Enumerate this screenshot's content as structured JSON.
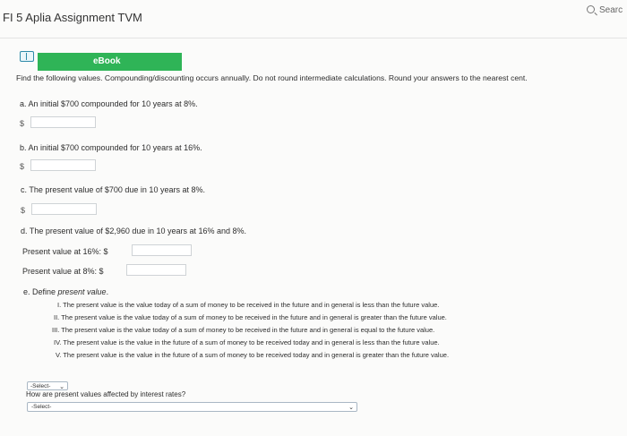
{
  "header": {
    "title": "FI 5 Aplia Assignment TVM",
    "search_label": "Searc"
  },
  "ebook": {
    "label": "eBook"
  },
  "instructions": "Find the following values. Compounding/discounting occurs annually. Do not round intermediate calculations. Round your answers to the nearest cent.",
  "q_a": {
    "text": "a. An initial $700 compounded for 10 years at 8%.",
    "currency": "$",
    "value": ""
  },
  "q_b": {
    "text": "b. An initial $700 compounded for 10 years at 16%.",
    "currency": "$",
    "value": ""
  },
  "q_c": {
    "text": "c. The present value of $700 due in 10 years at 8%.",
    "currency": "$",
    "value": ""
  },
  "q_d": {
    "text": "d. The present value of $2,960 due in 10 years at 16% and 8%.",
    "pv16_label": "Present value at 16%: $",
    "pv8_label": "Present value at 8%: $",
    "pv16_value": "",
    "pv8_value": ""
  },
  "q_e": {
    "prefix": "e. Define ",
    "term": "present value",
    "suffix": ".",
    "options": [
      "I. The present value is the value today of a sum of money to be received in the future and in general is less than the future value.",
      "II. The present value is the value today of a sum of money to be received in the future and in general is greater than the future value.",
      "III. The present value is the value today of a sum of money to be received in the future and in general is equal to the future value.",
      "IV. The present value is the value in the future of a sum of money to be received today and in general is less than the future value.",
      "V. The present value is the value in the future of a sum of money to be received today and in general is greater than the future value."
    ],
    "select_value": "-Select-",
    "question2": "How are present values affected by interest rates?",
    "select2_value": "-Select-"
  }
}
